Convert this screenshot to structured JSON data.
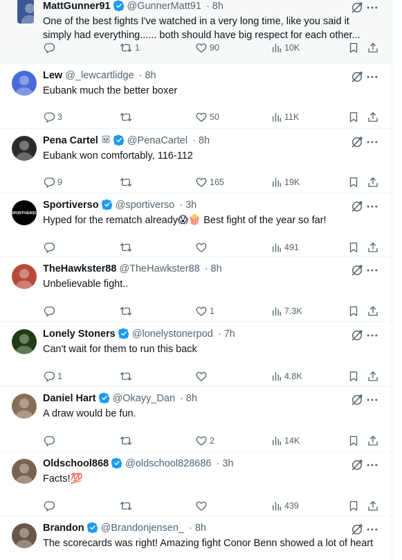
{
  "tweets": [
    {
      "name": "MattGunner91",
      "verified": true,
      "handle": "@GunnerMatt91",
      "time": "· 8h",
      "text": "One of the best fights I've watched in a very long time, like you said it simply had everything...... both should have big respect for each other...",
      "replies": "",
      "retweets": "1",
      "likes": "90",
      "views": "10K",
      "avatar_color": "#3b5998"
    },
    {
      "name": "Lew",
      "verified": false,
      "handle": "@_lewcartlidge",
      "time": "· 8h",
      "text": "Eubank much the better boxer",
      "replies": "3",
      "retweets": "",
      "likes": "50",
      "views": "11K",
      "avatar_color": "#4a6ad8"
    },
    {
      "name": "Pena Cartel",
      "verified": true,
      "handle": "@PenaCartel",
      "time": "· 8h",
      "text": "Eubank won comfortably, 116-112",
      "replies": "9",
      "retweets": "",
      "likes": "165",
      "views": "19K",
      "avatar_color": "#2b2b2b"
    },
    {
      "name": "Sportiverso",
      "verified": true,
      "handle": "@sportiverso",
      "time": "· 3h",
      "text": "Hyped for the rematch already😱🍿 Best fight of the year so far!",
      "replies": "",
      "retweets": "",
      "likes": "",
      "views": "491",
      "avatar_color": "#000000",
      "avatar_text": "SPORTIVERSO"
    },
    {
      "name": "TheHawkster88",
      "verified": false,
      "handle": "@TheHawkster88",
      "time": "· 8h",
      "text": "Unbelievable fight..",
      "replies": "",
      "retweets": "",
      "likes": "1",
      "views": "7.3K",
      "avatar_color": "#b84a3a"
    },
    {
      "name": "Lonely Stoners",
      "verified": true,
      "handle": "@lonelystonerpod",
      "time": "· 7h",
      "text": "Can't wait for them to run this back",
      "replies": "1",
      "retweets": "",
      "likes": "",
      "views": "4.8K",
      "avatar_color": "#1f3d14"
    },
    {
      "name": "Daniel Hart",
      "verified": true,
      "handle": "@Okayy_Dan",
      "time": "· 8h",
      "text": "A draw would be fun.",
      "replies": "",
      "retweets": "",
      "likes": "2",
      "views": "14K",
      "avatar_color": "#8a6d55"
    },
    {
      "name": "Oldschool868",
      "verified": true,
      "handle": "@oldschool828686",
      "time": "· 3h",
      "text": "Facts!💯",
      "replies": "",
      "retweets": "",
      "likes": "",
      "views": "439",
      "avatar_color": "#7a6250"
    },
    {
      "name": "Brandon",
      "verified": true,
      "handle": "@Brandonjensen_",
      "time": "· 8h",
      "text": "The scorecards was right! Amazing fight Conor Benn showed a lot of heart",
      "replies": "",
      "retweets": "",
      "likes": "",
      "views": "",
      "avatar_color": "#6b5648"
    }
  ],
  "icons": {
    "reply": "reply-icon",
    "retweet": "retweet-icon",
    "like": "heart-icon",
    "views": "views-icon",
    "bookmark": "bookmark-icon",
    "share": "share-icon",
    "grok": "grok-icon",
    "more": "more-icon",
    "verified": "verified-badge-icon"
  },
  "colors": {
    "verified": "#1d9bf0",
    "muted": "#536471",
    "text": "#0f1419"
  }
}
